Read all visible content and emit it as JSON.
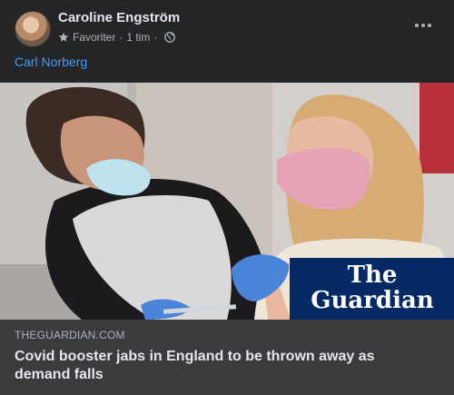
{
  "post": {
    "author": "Caroline Engström",
    "audience_label": "Favoriter",
    "separator": "·",
    "timestamp": "1 tim",
    "message": "Carl Norberg",
    "more_icon": "ellipsis-icon",
    "audience_icon": "star-icon",
    "privacy_icon": "globe-icon"
  },
  "link": {
    "domain": "THEGUARDIAN.COM",
    "headline": "Covid booster jabs in England to be thrown away as demand falls",
    "logo_text_line1": "The",
    "logo_text_line2": "Guardian"
  },
  "colors": {
    "card_bg": "#242526",
    "link_bar_bg": "#3a3b3c",
    "link_text": "#4599ff",
    "guardian_blue": "#052962"
  }
}
